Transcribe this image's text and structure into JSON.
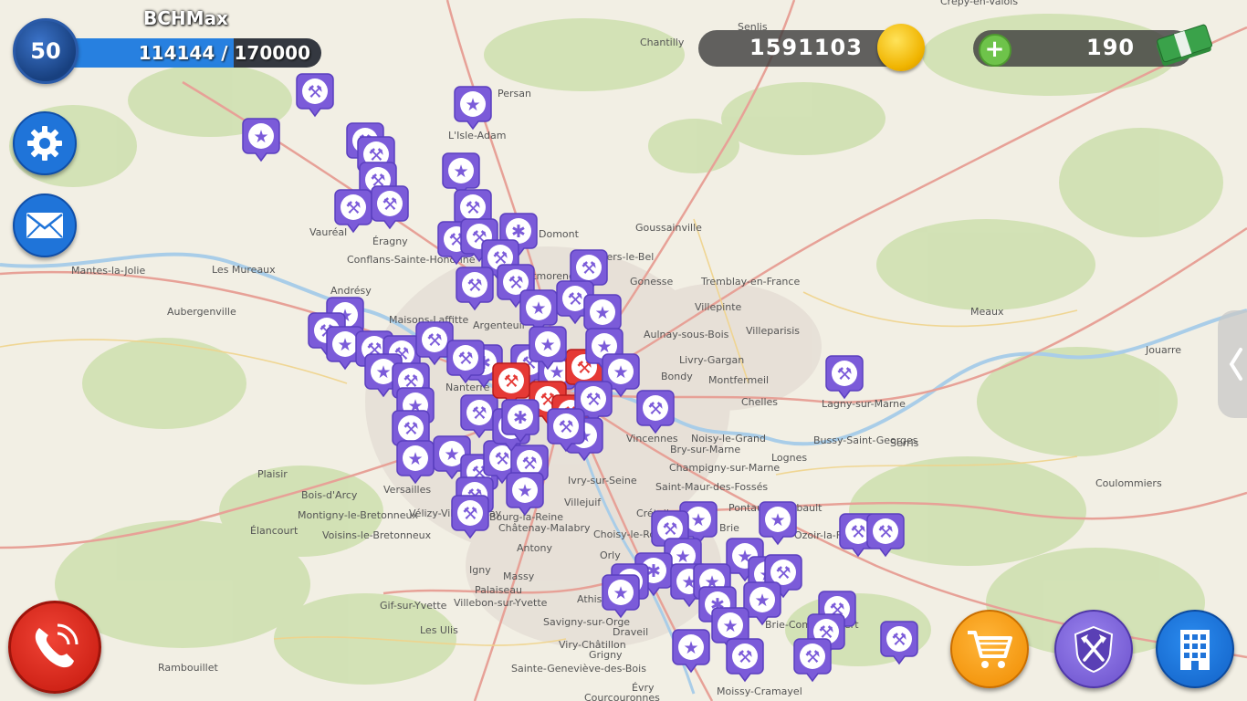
{
  "player": {
    "name": "BCHMax",
    "level": "50",
    "xp_current": "114144",
    "xp_separator": "/",
    "xp_max": "170000",
    "xp_text": "114144 / 170000",
    "xp_progress": 0.671
  },
  "currency": {
    "coins": "1591103",
    "coins_icon": "coin-icon",
    "cash": "190",
    "cash_icon": "banknote-icon",
    "add_icon": "plus-icon"
  },
  "buttons": {
    "settings_icon": "gear-icon",
    "messages_icon": "envelope-icon",
    "side_panel_icon": "chevron-left-icon",
    "call_icon": "phone-icon",
    "shop_icon": "shopping-cart-icon",
    "alliance_icon": "crossed-axes-shield-icon",
    "buildings_icon": "building-icon"
  },
  "colors": {
    "marker_purple": "#7b5bd9",
    "marker_red": "#e53935",
    "accent_blue": "#1f74d9",
    "call_red": "#d8261a",
    "shop_orange": "#f5a01c",
    "coin_gold": "#f5c20e",
    "cash_green": "#3aa24a"
  },
  "map_labels": [
    "Senlis",
    "Crépy-en-Valois",
    "Chantilly",
    "Persan",
    "L'Isle-Adam",
    "Vauréal",
    "Éragny",
    "Conflans-Sainte-Honorine",
    "Goussainville",
    "Domont",
    "Villiers-le-Bel",
    "Gonesse",
    "Tremblay-en-France",
    "Villepinte",
    "Mantes-la-Jolie",
    "Les Mureaux",
    "Aubergenville",
    "Andrésy",
    "Maisons-Laffitte",
    "Argenteuil",
    "Aulnay-sous-Bois",
    "Villeparisis",
    "Livry-Gargan",
    "Bondy",
    "Montfermeil",
    "Meaux",
    "Jouarre",
    "Chelles",
    "Lagny-sur-Marne",
    "Noisy-le-Grand",
    "Bry-sur-Marne",
    "Vincennes",
    "Bussy-Saint-Georges",
    "Serris",
    "Lognes",
    "Champigny-sur-Marne",
    "Saint-Maur-des-Fossés",
    "Pontault-Combault",
    "Plaisir",
    "Bois-d'Arcy",
    "Versailles",
    "Montigny-le-Bretonneux",
    "Voisins-le-Bretonneux",
    "Élancourt",
    "Vélizy-Villacoublay",
    "Châtenay-Malabry",
    "Antony",
    "Bourg-la-Reine",
    "Villejuif",
    "Ivry-sur-Seine",
    "Choisy-le-Roi",
    "Créteil",
    "Brie",
    "Orly",
    "Igny",
    "Massy",
    "Palaiseau",
    "Villebon-sur-Yvette",
    "Gif-sur-Yvette",
    "Les Ulis",
    "Athis",
    "Savigny-sur-Orge",
    "Viry-Châtillon",
    "Grigny",
    "Draveil",
    "Rambouillet",
    "Sainte-Geneviève-des-Bois",
    "Évry",
    "Courcouronnes",
    "Moissy-Cramayel",
    "Coulommiers",
    "Brie-Comte-Robert",
    "Ozoir-la-Ferrière",
    "Montmorency",
    "Nanterre"
  ]
}
